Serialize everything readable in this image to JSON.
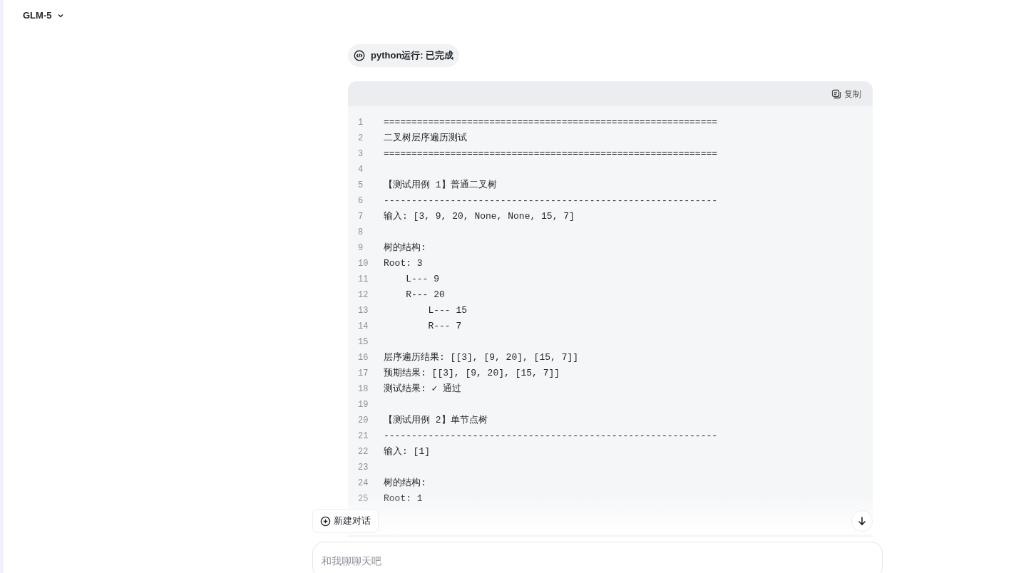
{
  "model_selector": {
    "label": "GLM-5"
  },
  "tool_status": {
    "label": "python运行: 已完成"
  },
  "code_block": {
    "copy_label": "复制",
    "lines": [
      {
        "number": "1",
        "text": "============================================================"
      },
      {
        "number": "2",
        "text": "二叉树层序遍历测试"
      },
      {
        "number": "3",
        "text": "============================================================"
      },
      {
        "number": "4"
      },
      {
        "number": "5",
        "text": "【测试用例 1】普通二叉树"
      },
      {
        "number": "6",
        "text": "------------------------------------------------------------"
      },
      {
        "number": "7",
        "text": "输入: [3, 9, 20, None, None, 15, 7]"
      },
      {
        "number": "8"
      },
      {
        "number": "9",
        "text": "树的结构:"
      },
      {
        "number": "10",
        "text": "Root: 3"
      },
      {
        "number": "11",
        "text": "    L--- 9"
      },
      {
        "number": "12",
        "text": "    R--- 20"
      },
      {
        "number": "13",
        "text": "        L--- 15"
      },
      {
        "number": "14",
        "text": "        R--- 7"
      },
      {
        "number": "15"
      },
      {
        "number": "16",
        "text": "层序遍历结果: [[3], [9, 20], [15, 7]]"
      },
      {
        "number": "17",
        "text": "预期结果: [[3], [9, 20], [15, 7]]"
      },
      {
        "number": "18",
        "text": "测试结果: ✓ 通过"
      },
      {
        "number": "19"
      },
      {
        "number": "20",
        "text": "【测试用例 2】单节点树"
      },
      {
        "number": "21",
        "text": "------------------------------------------------------------"
      },
      {
        "number": "22",
        "text": "输入: [1]"
      },
      {
        "number": "23"
      },
      {
        "number": "24",
        "text": "树的结构:"
      },
      {
        "number": "25",
        "text": "Root: 1"
      }
    ]
  },
  "new_chat_button": {
    "label": "新建对话"
  },
  "chat_input": {
    "placeholder": "和我聊聊天吧"
  }
}
